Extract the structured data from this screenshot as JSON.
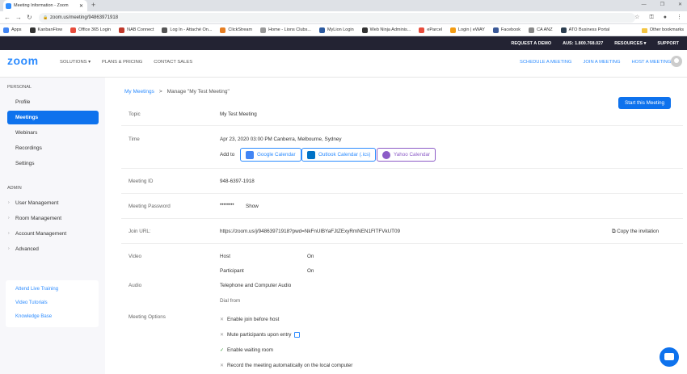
{
  "browser": {
    "tab_title": "Meeting Information - Zoom",
    "url": "zoom.us/meeting/94863971918",
    "bookmarks": [
      {
        "label": "Apps",
        "color": "#4285f4"
      },
      {
        "label": "KanbanFlow",
        "color": "#333"
      },
      {
        "label": "Office 365 Login",
        "color": "#e74c3c"
      },
      {
        "label": "NAB Connect",
        "color": "#c0392b"
      },
      {
        "label": "Log In - Attaché On...",
        "color": "#555"
      },
      {
        "label": "ClickStream",
        "color": "#e67e22"
      },
      {
        "label": "Home - Lions Clubs...",
        "color": "#999"
      },
      {
        "label": "MyLion Login",
        "color": "#2c5aa0"
      },
      {
        "label": "Web Ninja Adminis...",
        "color": "#333"
      },
      {
        "label": "eParcel",
        "color": "#e74c3c"
      },
      {
        "label": "Login | eWAY",
        "color": "#f39c12"
      },
      {
        "label": "Facebook",
        "color": "#3b5998"
      },
      {
        "label": "CA ANZ",
        "color": "#888"
      },
      {
        "label": "ATO Business Portal",
        "color": "#2c3e50"
      }
    ],
    "other_bookmarks": "Other bookmarks"
  },
  "topbar": {
    "request_demo": "REQUEST A DEMO",
    "phone": "AUS: 1.800.768.027",
    "resources": "RESOURCES ▾",
    "support": "SUPPORT"
  },
  "nav": {
    "logo": "zoom",
    "solutions": "SOLUTIONS ▾",
    "plans": "PLANS & PRICING",
    "contact": "CONTACT SALES",
    "schedule": "SCHEDULE A MEETING",
    "join": "JOIN A MEETING",
    "host": "HOST A MEETING ▾"
  },
  "sidebar": {
    "personal": "PERSONAL",
    "admin": "ADMIN",
    "personal_items": [
      "Profile",
      "Meetings",
      "Webinars",
      "Recordings",
      "Settings"
    ],
    "admin_items": [
      "User Management",
      "Room Management",
      "Account Management",
      "Advanced"
    ],
    "help_links": [
      "Attend Live Training",
      "Video Tutorials",
      "Knowledge Base"
    ]
  },
  "main": {
    "crumb_link": "My Meetings",
    "crumb_sep": ">",
    "crumb_current": "Manage \"My Test Meeting\"",
    "start_button": "Start this Meeting",
    "topic_label": "Topic",
    "topic": "My Test Meeting",
    "time_label": "Time",
    "time": "Apr 23, 2020 03:00 PM Canberra, Melbourne, Sydney",
    "add_to": "Add to",
    "google": "Google Calendar",
    "outlook": "Outlook Calendar (.ics)",
    "yahoo": "Yahoo Calendar",
    "id_label": "Meeting ID",
    "meeting_id": "948-6397-1918",
    "password_label": "Meeting Password",
    "password": "••••••••",
    "show": "Show",
    "join_label": "Join URL:",
    "join_url": "https://zoom.us/j/94863971918?pwd=NkFnUlBYaFJtZExyRmNEN1FITFVkUT09",
    "copy": "Copy the invitation",
    "video_label": "Video",
    "host": "Host",
    "host_val": "On",
    "participant": "Participant",
    "participant_val": "On",
    "audio_label": "Audio",
    "audio": "Telephone and Computer Audio",
    "dial": "Dial from",
    "options_label": "Meeting Options",
    "options": [
      {
        "text": "Enable join before host",
        "on": false
      },
      {
        "text": "Mute participants upon entry",
        "on": false
      },
      {
        "text": "Enable waiting room",
        "on": true
      },
      {
        "text": "Record the meeting automatically on the local computer",
        "on": false
      }
    ]
  }
}
